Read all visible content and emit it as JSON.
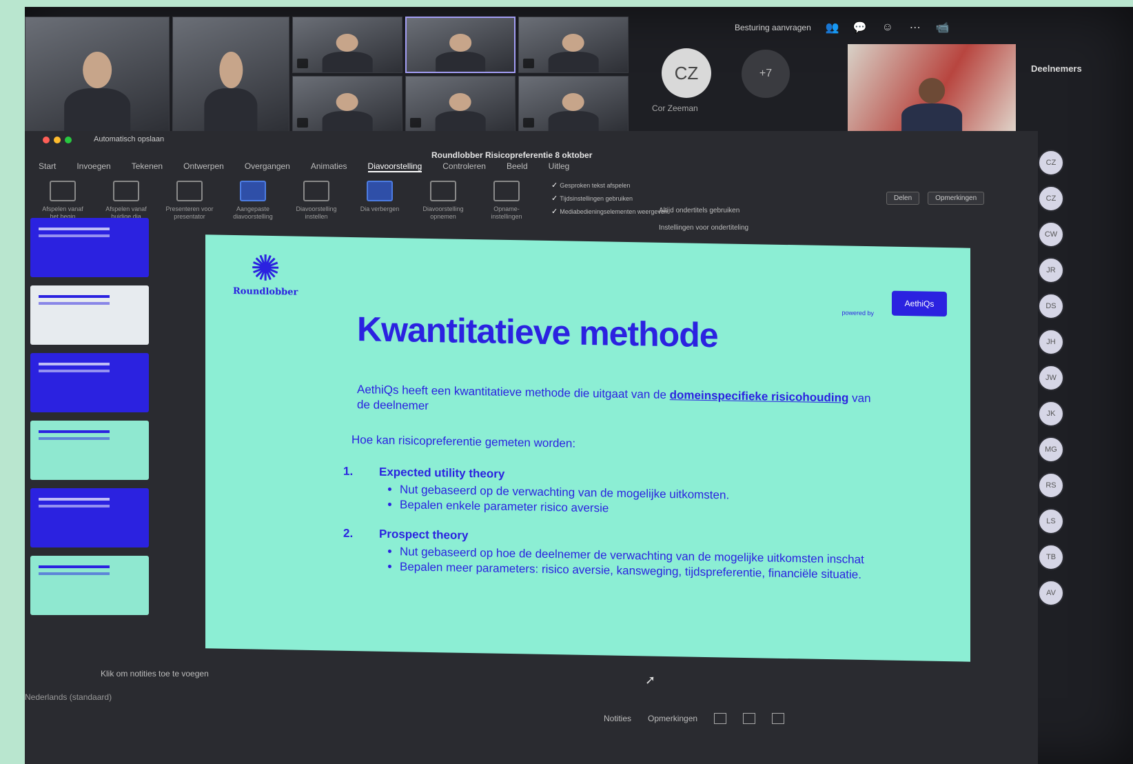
{
  "teams": {
    "topbar": {
      "request_control": "Besturing aanvragen"
    },
    "overflow_count": "+7",
    "cz_initials": "CZ",
    "cz_name": "Cor Zeeman",
    "panel_title": "Deelnemers",
    "participants": [
      "CZ",
      "CZ",
      "CW",
      "JR",
      "DS",
      "JH",
      "JW",
      "JK",
      "MG",
      "RS",
      "LS",
      "TB",
      "AV"
    ]
  },
  "ppt": {
    "autosave": "Automatisch opslaan",
    "doc_title": "Roundlobber Risicopreferentie 8 oktober",
    "tabs": [
      "Start",
      "Invoegen",
      "Tekenen",
      "Ontwerpen",
      "Overgangen",
      "Animaties",
      "Diavoorstelling",
      "Controleren",
      "Beeld",
      "Uitleg"
    ],
    "active_tab": "Diavoorstelling",
    "ribbon_buttons": [
      "Afspelen vanaf het begin",
      "Afspelen vanaf huidige dia",
      "Presenteren voor presentator",
      "Aangepaste diavoorstelling",
      "Diavoorstelling instellen",
      "Dia verbergen",
      "Diavoorstelling opnemen",
      "Opname-instellingen"
    ],
    "ribbon_checks": [
      "Gesproken tekst afspelen",
      "Tijdsinstellingen gebruiken",
      "Mediabedieningselementen weergeven"
    ],
    "ribbon_opts": [
      "Altijd ondertitels gebruiken",
      "Instellingen voor ondertiteling"
    ],
    "actions": [
      "Delen",
      "Opmerkingen"
    ],
    "notes_placeholder": "Klik om notities toe te voegen",
    "language": "Nederlands (standaard)",
    "status_notes": "Notities",
    "status_comments": "Opmerkingen"
  },
  "slide": {
    "logo_word": "Roundlobber",
    "badge_caption": "powered by",
    "badge": "AethiQs",
    "title": "Kwantitatieve methode",
    "intro_pre": "AethiQs heeft een kwantitatieve methode die uitgaat van de ",
    "intro_bold": "domeinspecifieke risicohouding",
    "intro_post": " van de deelnemer",
    "question": "Hoe kan risicopreferentie gemeten worden:",
    "items": [
      {
        "num": "1.",
        "head": "Expected utility theory",
        "bullets": [
          "Nut gebaseerd op de verwachting van de mogelijke uitkomsten.",
          "Bepalen enkele parameter risico aversie"
        ]
      },
      {
        "num": "2.",
        "head": "Prospect theory",
        "bullets": [
          "Nut gebaseerd op hoe de deelnemer de verwachting van de mogelijke uitkomsten inschat",
          "Bepalen meer parameters: risico aversie, kansweging, tijdspreferentie, financiële situatie."
        ]
      }
    ]
  },
  "colors": {
    "slide_bg": "#8ceed4",
    "brand_blue": "#2b22e0",
    "app_bg": "#1e1f24"
  }
}
